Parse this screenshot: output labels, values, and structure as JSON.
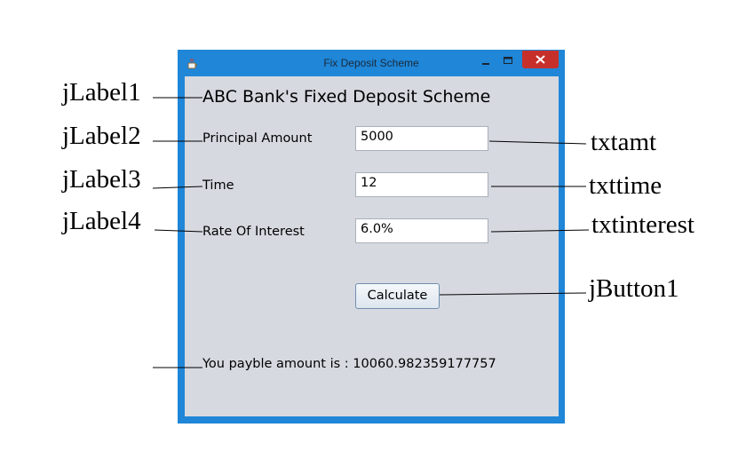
{
  "window": {
    "title": "Fix Deposit Scheme",
    "controls": {
      "minimize": "minimize",
      "maximize": "maximize",
      "close": "close"
    }
  },
  "form": {
    "heading": "ABC Bank's Fixed Deposit Scheme",
    "principal_label": "Principal Amount",
    "principal_value": "5000",
    "time_label": "Time",
    "time_value": "12",
    "rate_label": "Rate Of Interest",
    "rate_value": "6.0%",
    "calculate_label": "Calculate",
    "result_text": "You payble amount is : 10060.982359177757"
  },
  "annotations": {
    "label1": "jLabel1",
    "label2": "jLabel2",
    "label3": "jLabel3",
    "label4": "jLabel4",
    "amt": "txtamt",
    "time": "txttime",
    "interest": "txtinterest",
    "button": "jButton1"
  },
  "colors": {
    "title_bar": "#1f86d8",
    "client_bg": "#d6d9e0",
    "close_button": "#c7302a"
  }
}
